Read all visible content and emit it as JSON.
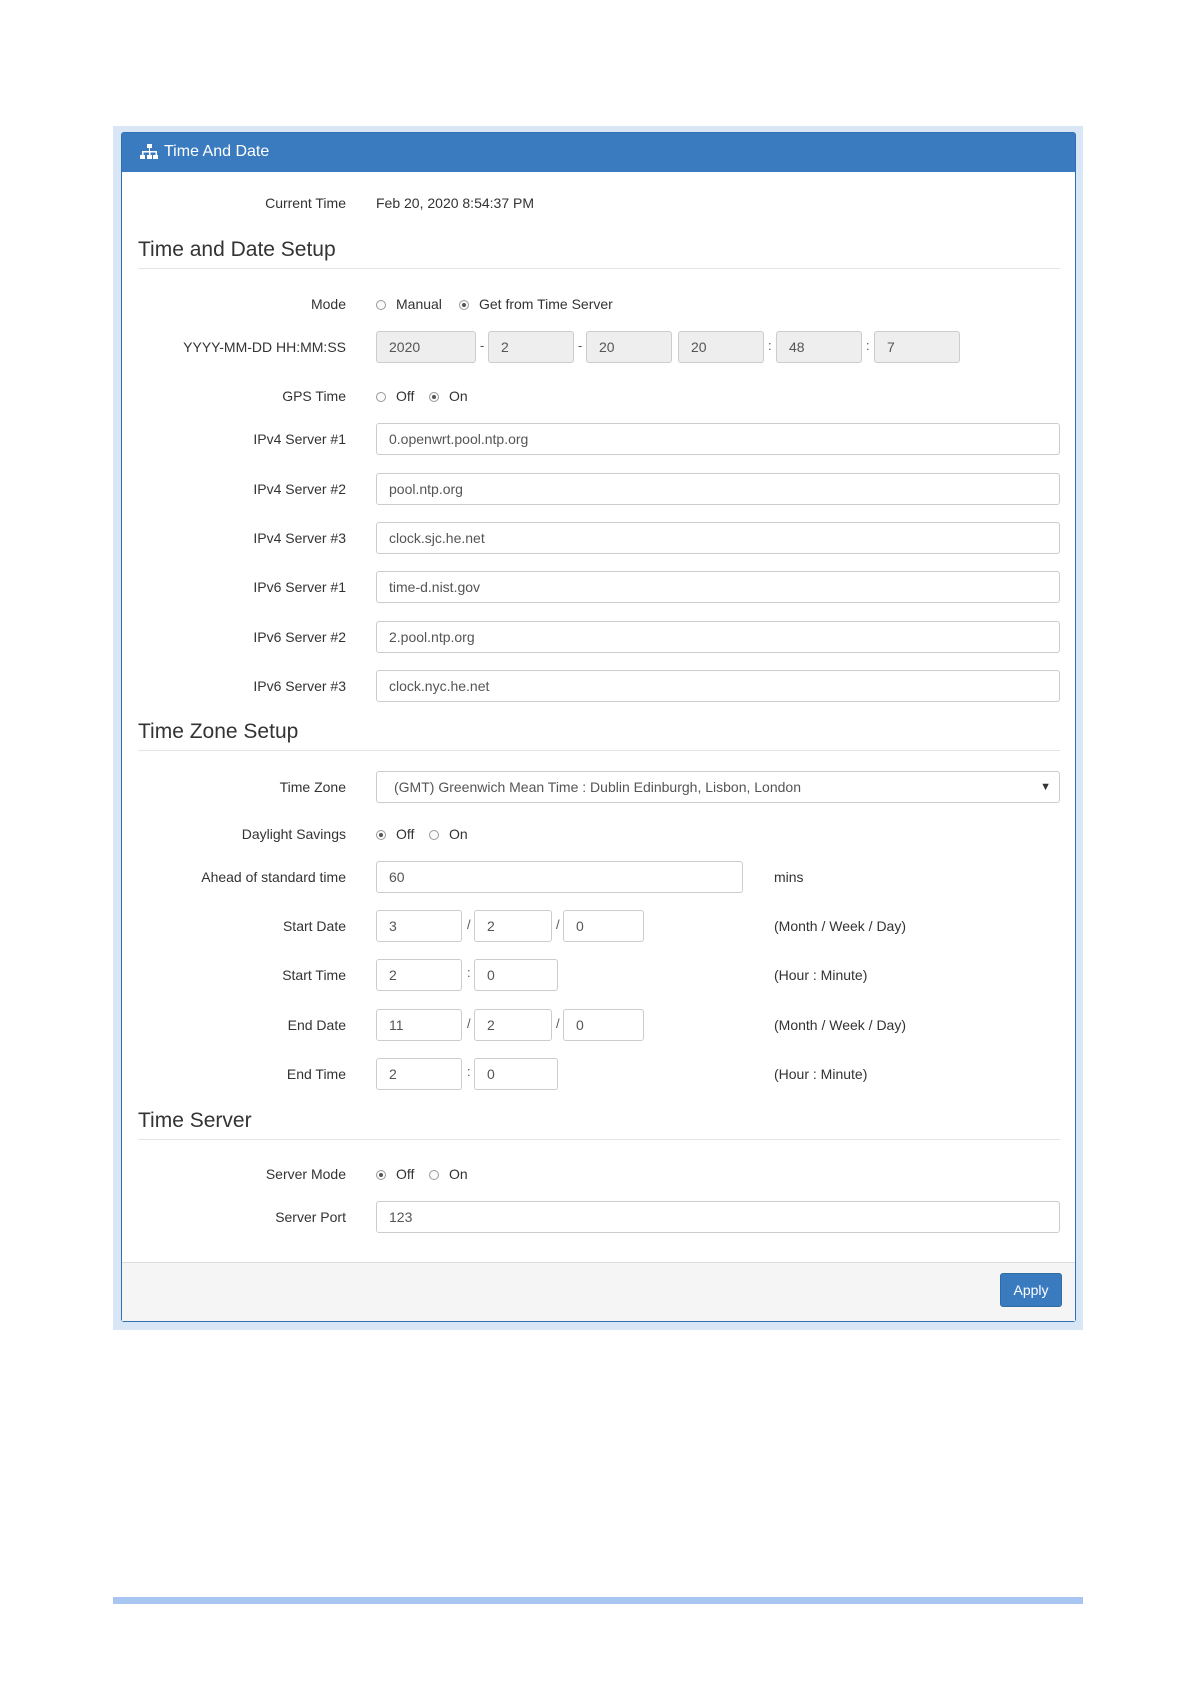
{
  "panel": {
    "title": "Time And Date",
    "title_icon": "sitemap-icon"
  },
  "current_time": {
    "label": "Current Time",
    "value": "Feb 20, 2020 8:54:37 PM"
  },
  "sections": {
    "time_date_setup": "Time and Date Setup",
    "time_zone_setup": "Time Zone Setup",
    "time_server": "Time Server"
  },
  "mode": {
    "label": "Mode",
    "options": [
      "Manual",
      "Get from Time Server"
    ],
    "selected": "Get from Time Server"
  },
  "datetime": {
    "label": "YYYY-MM-DD HH:MM:SS",
    "year": "2020",
    "month": "2",
    "day": "20",
    "hour": "20",
    "minute": "48",
    "second": "7",
    "sep_date": "-",
    "sep_time": ":"
  },
  "gps_time": {
    "label": "GPS Time",
    "options": [
      "Off",
      "On"
    ],
    "selected": "On"
  },
  "servers": [
    {
      "label": "IPv4 Server #1",
      "value": "0.openwrt.pool.ntp.org"
    },
    {
      "label": "IPv4 Server #2",
      "value": "pool.ntp.org"
    },
    {
      "label": "IPv4 Server #3",
      "value": "clock.sjc.he.net"
    },
    {
      "label": "IPv6 Server #1",
      "value": "time-d.nist.gov"
    },
    {
      "label": "IPv6 Server #2",
      "value": "2.pool.ntp.org"
    },
    {
      "label": "IPv6 Server #3",
      "value": "clock.nyc.he.net"
    }
  ],
  "time_zone": {
    "label": "Time Zone",
    "value": "(GMT) Greenwich Mean Time : Dublin Edinburgh, Lisbon, London",
    "caret": "▼"
  },
  "daylight_savings": {
    "label": "Daylight Savings",
    "options": [
      "Off",
      "On"
    ],
    "selected": "Off"
  },
  "ahead": {
    "label": "Ahead of standard time",
    "value": "60",
    "unit": "mins"
  },
  "start_date": {
    "label": "Start Date",
    "month": "3",
    "week": "2",
    "day": "0",
    "sep": "/",
    "hint": "(Month / Week / Day)"
  },
  "start_time": {
    "label": "Start Time",
    "hour": "2",
    "minute": "0",
    "sep": ":",
    "hint": "(Hour : Minute)"
  },
  "end_date": {
    "label": "End Date",
    "month": "11",
    "week": "2",
    "day": "0",
    "sep": "/",
    "hint": "(Month / Week / Day)"
  },
  "end_time": {
    "label": "End Time",
    "hour": "2",
    "minute": "0",
    "sep": ":",
    "hint": "(Hour : Minute)"
  },
  "server_mode": {
    "label": "Server Mode",
    "options": [
      "Off",
      "On"
    ],
    "selected": "Off"
  },
  "server_port": {
    "label": "Server Port",
    "value": "123"
  },
  "footer": {
    "apply_label": "Apply"
  },
  "colors": {
    "header": "#3a7bbf",
    "frame": "#d9e6f6",
    "bottom_bar": "#a9c6f2"
  }
}
